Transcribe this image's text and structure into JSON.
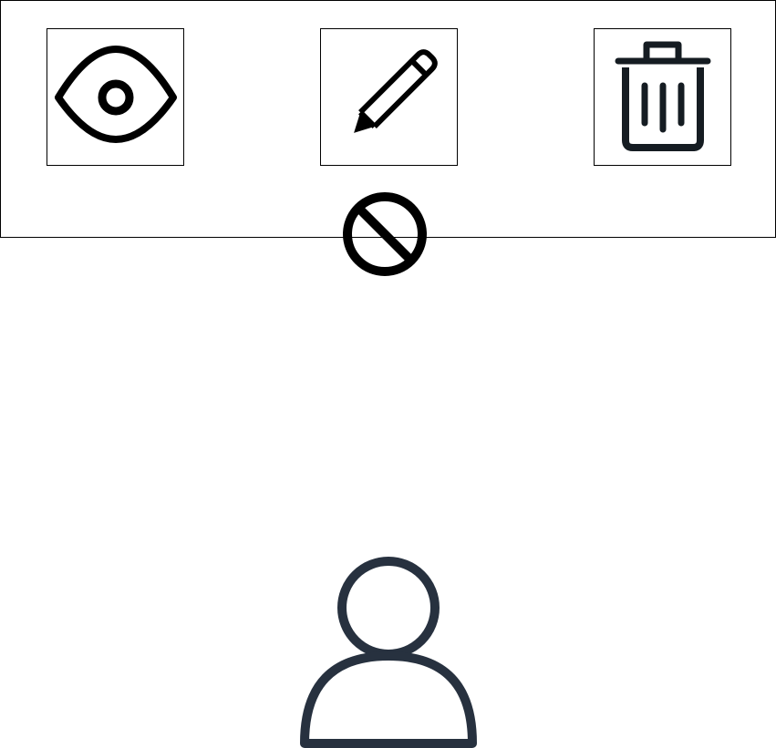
{
  "colors": {
    "icon_stroke": "#000000",
    "trash_stroke": "#151c22",
    "user_stroke": "#27313f",
    "frame_border": "#000000",
    "background": "#ffffff"
  },
  "icons": {
    "view": "eye-icon",
    "edit": "pencil-icon",
    "delete": "trash-icon",
    "denied": "prohibited-icon",
    "actor": "user-icon"
  }
}
